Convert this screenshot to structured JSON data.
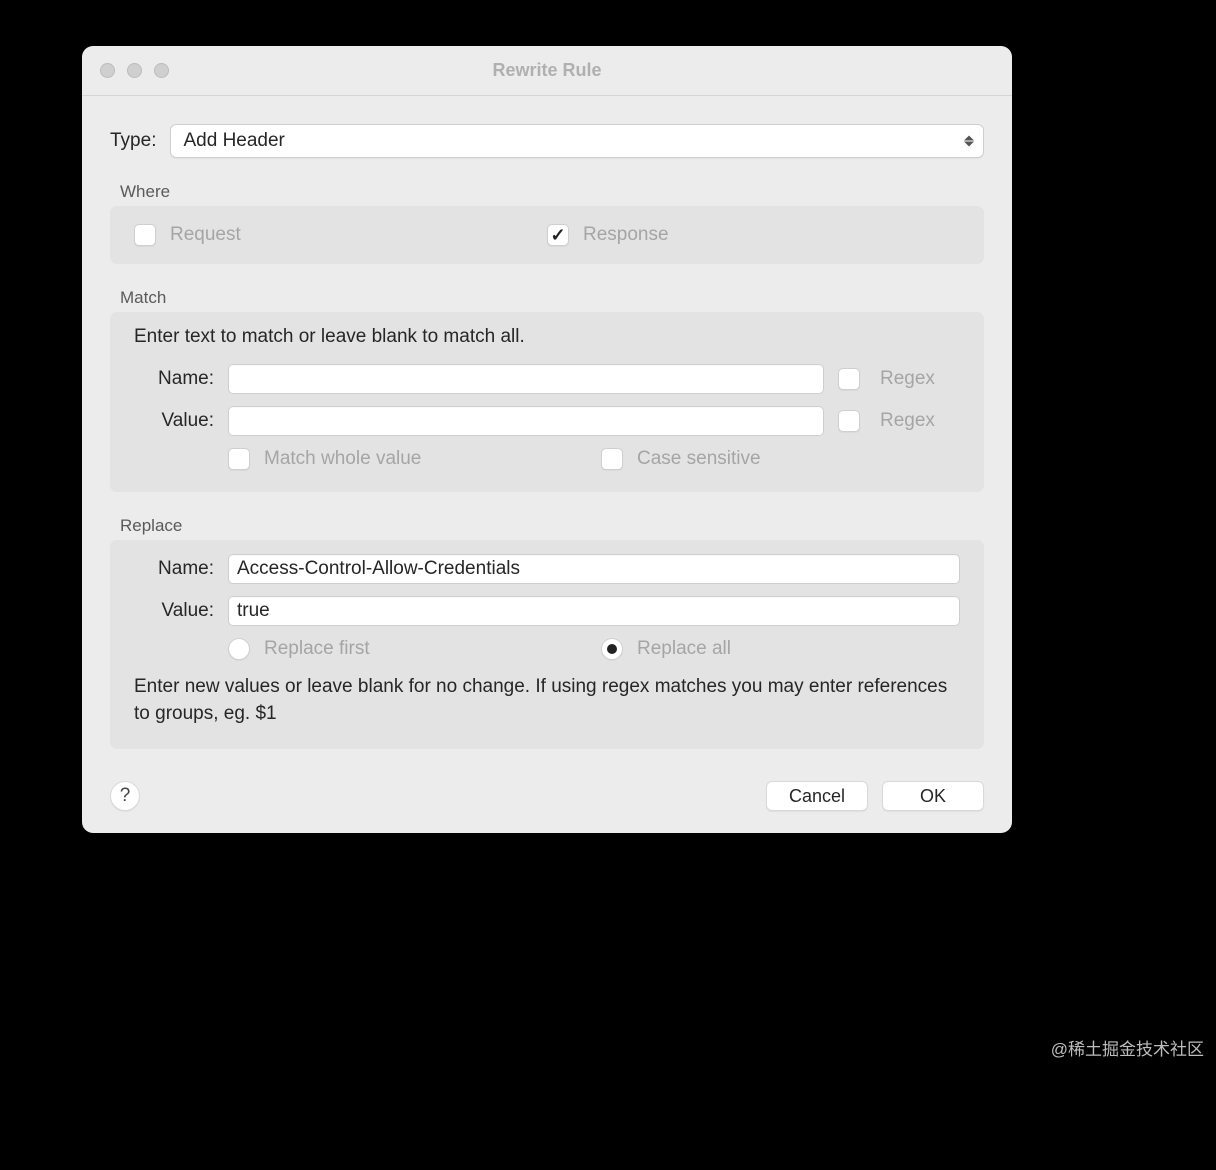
{
  "window": {
    "title": "Rewrite Rule"
  },
  "type": {
    "label": "Type:",
    "selected": "Add Header"
  },
  "where": {
    "section": "Where",
    "request": {
      "label": "Request",
      "checked": false
    },
    "response": {
      "label": "Response",
      "checked": true
    }
  },
  "match": {
    "section": "Match",
    "hint": "Enter text to match or leave blank to match all.",
    "name_label": "Name:",
    "name_value": "",
    "name_regex_label": "Regex",
    "name_regex_checked": false,
    "value_label": "Value:",
    "value_value": "",
    "value_regex_label": "Regex",
    "value_regex_checked": false,
    "whole_label": "Match whole value",
    "whole_checked": false,
    "case_label": "Case sensitive",
    "case_checked": false
  },
  "replace": {
    "section": "Replace",
    "name_label": "Name:",
    "name_value": "Access-Control-Allow-Credentials",
    "value_label": "Value:",
    "value_value": "true",
    "first_label": "Replace first",
    "all_label": "Replace all",
    "mode": "all",
    "hint": "Enter new values or leave blank for no change. If using regex matches you may enter references to groups, eg. $1"
  },
  "footer": {
    "help": "?",
    "cancel": "Cancel",
    "ok": "OK"
  },
  "watermark": "@稀土掘金技术社区"
}
